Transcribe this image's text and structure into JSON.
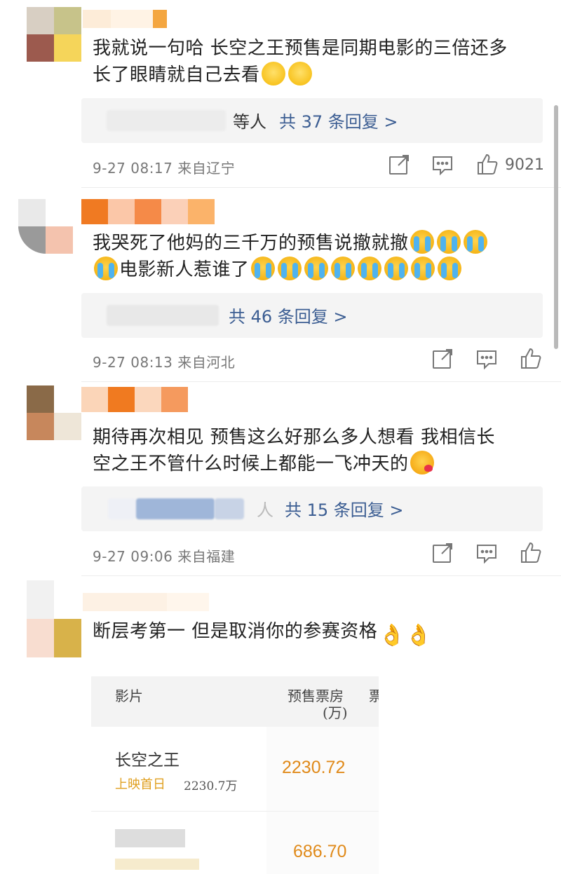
{
  "colors": {
    "reply_link": "#3b5d92",
    "meta": "#777777",
    "orange_value": "#e08a1a",
    "label_yellow": "#e0a020"
  },
  "comments": [
    {
      "text_line1": "我就说一句哈 长空之王预售是同期电影的三倍还多",
      "text_line2": "长了眼睛就自己去看",
      "emojis": [
        "shy-face-icon",
        "shy-face-icon"
      ],
      "reply_prefix_visible": "等人",
      "reply_label": "共 37 条回复 >",
      "time": "9-27 08:17",
      "location": "来自辽宁",
      "like_count": "9021"
    },
    {
      "text_line1": "我哭死了他妈的三千万的预售说撤就撤",
      "text_line2": "电影新人惹谁了",
      "reply_label": "共 46 条回复 >",
      "time": "9-27 08:13",
      "location": "来自河北",
      "like_count": ""
    },
    {
      "text_line1": "期待再次相见 预售这么好那么多人想看 我相信长",
      "text_line2": "空之王不管什么时候上都能一飞冲天的",
      "reply_prefix_visible": "人",
      "reply_label": "共 15 条回复 >",
      "time": "9-27 09:06",
      "location": "来自福建",
      "like_count": ""
    },
    {
      "text_line1": "断层考第一 但是取消你的参赛资格",
      "emoji_ok": "👌"
    }
  ],
  "table": {
    "col1_header": "影片",
    "col2_header_line1": "预售票房",
    "col2_header_line2": "(万)",
    "col3_header_partial": "票",
    "rows": [
      {
        "film": "长空之王",
        "tag": "上映首日",
        "sub_value": "2230.7万",
        "presale": "2230.72"
      },
      {
        "film": "",
        "tag": "",
        "sub_value": "",
        "presale": "686.70"
      }
    ]
  }
}
